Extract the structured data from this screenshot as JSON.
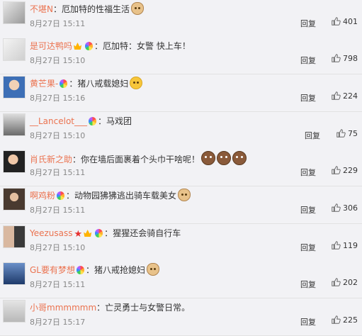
{
  "reply_label": "回复",
  "colors": {
    "username": "#eb7350",
    "text": "#333333",
    "meta": "#888888",
    "background": "#f2f2f5"
  },
  "comments": [
    {
      "username": "不堪N",
      "badges": [],
      "text": "厄加特的性福生活",
      "emoji": [
        "dog-face-icon"
      ],
      "date": "8月27日",
      "time": "15:11",
      "likes": "401"
    },
    {
      "username": "是可达鸭吗",
      "badges": [
        "vip-crown-icon",
        "rainbow-badge-icon"
      ],
      "text": "厄加特：女警 快上车！",
      "emoji": [],
      "date": "8月27日",
      "time": "15:10",
      "likes": "798"
    },
    {
      "username": "黄芒果-",
      "badges": [
        "rainbow-badge-icon"
      ],
      "text": "猪八戒载媳妇",
      "emoji": [
        "doge-icon"
      ],
      "date": "8月27日",
      "time": "15:16",
      "likes": "224"
    },
    {
      "username": "__Lancelot___",
      "badges": [
        "rainbow-badge-icon"
      ],
      "text": "马戏团",
      "emoji": [],
      "date": "8月27日",
      "time": "15:10",
      "likes": "75"
    },
    {
      "username": "肖氏新之助",
      "badges": [],
      "text": "你在墙后面裹着个头巾干啥呢！",
      "emoji": [
        "monk-face-icon",
        "monk-face-icon",
        "monk-face-icon"
      ],
      "date": "8月27日",
      "time": "15:11",
      "likes": "229"
    },
    {
      "username": "啊鸡粉",
      "badges": [
        "rainbow-badge-icon"
      ],
      "text": "动物园狒狒逃出骑车载美女",
      "emoji": [
        "dog-face-icon"
      ],
      "date": "8月27日",
      "time": "15:11",
      "likes": "306"
    },
    {
      "username": "Yeezusass",
      "badges": [
        "red-star-icon",
        "vip-crown-icon",
        "rainbow-badge-icon"
      ],
      "text": "猩猩还会骑自行车",
      "emoji": [],
      "date": "8月27日",
      "time": "15:10",
      "likes": "119"
    },
    {
      "username": "GL要有梦想",
      "badges": [
        "rainbow-badge-icon"
      ],
      "text": "猪八戒抢媳妇",
      "emoji": [
        "dog-face-icon"
      ],
      "date": "8月27日",
      "time": "15:11",
      "likes": "202"
    },
    {
      "username": "小哥mmmmmm",
      "badges": [],
      "text": "亡灵勇士与女警日常。",
      "emoji": [],
      "date": "8月27日",
      "time": "15:17",
      "likes": "225"
    }
  ]
}
